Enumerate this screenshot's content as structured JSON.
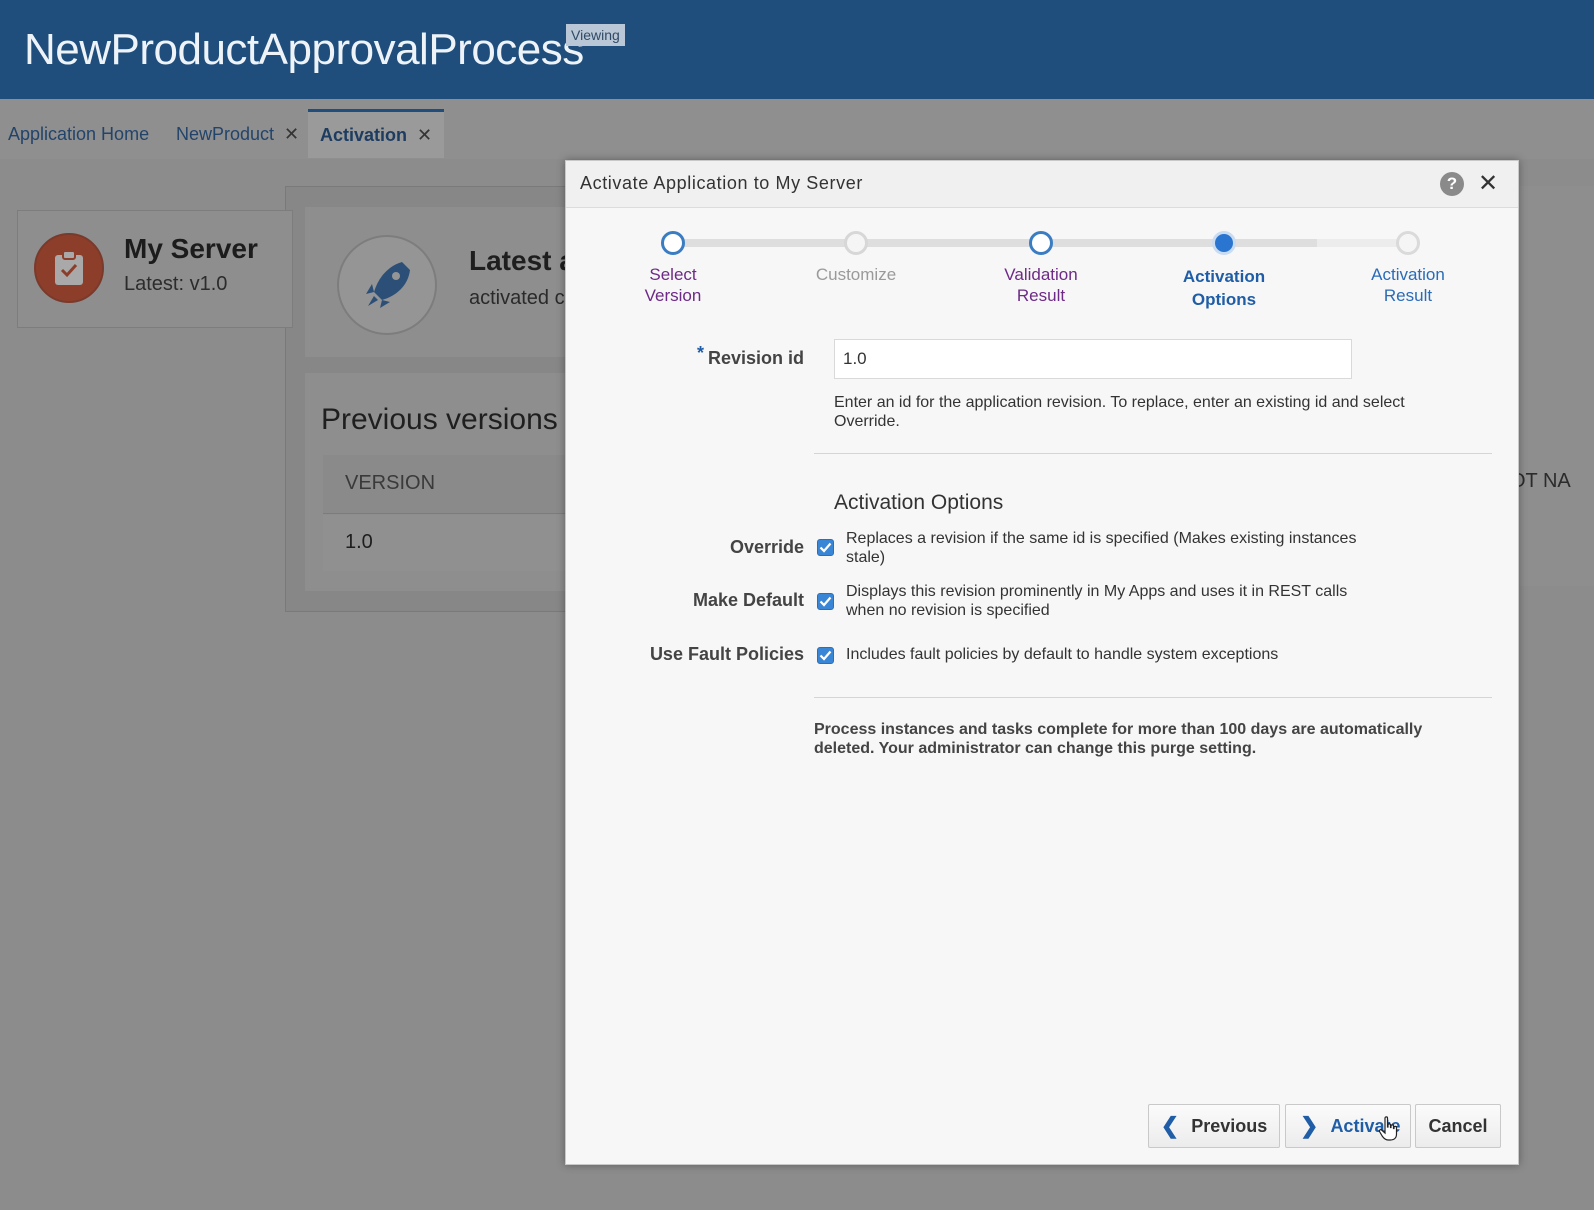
{
  "header": {
    "title": "NewProductApprovalProcess",
    "badge": "Viewing"
  },
  "tabs": [
    {
      "label": "Application Home",
      "closable": false
    },
    {
      "label": "NewProduct",
      "closable": true
    },
    {
      "label": "Activation",
      "closable": true,
      "active": true
    }
  ],
  "server_card": {
    "name": "My Server",
    "latest": "Latest: v1.0"
  },
  "latest_panel": {
    "title": "Latest a",
    "subtitle": "activated c"
  },
  "previous_versions": {
    "title": "Previous versions",
    "column": "VERSION",
    "rows": [
      "1.0"
    ],
    "peek_column": "OT NA"
  },
  "dialog": {
    "title": "Activate Application to My Server",
    "help_icon": "?",
    "close_icon": "✕",
    "steps": [
      {
        "label_line1": "Select",
        "label_line2": "Version",
        "state": "visited"
      },
      {
        "label_line1": "Customize",
        "label_line2": "",
        "state": "disabled"
      },
      {
        "label_line1": "Validation",
        "label_line2": "Result",
        "state": "visited"
      },
      {
        "label_line1": "Activation",
        "label_line2": "Options",
        "state": "current"
      },
      {
        "label_line1": "Activation",
        "label_line2": "Result",
        "state": "unvisited"
      }
    ],
    "revision": {
      "label": "Revision id",
      "required_marker": "*",
      "value": "1.0",
      "help": "Enter an id for the application revision. To replace, enter an existing id and select Override."
    },
    "options_heading": "Activation Options",
    "options": [
      {
        "label": "Override",
        "checked": true,
        "description": "Replaces a revision if the same id is specified (Makes existing instances stale)"
      },
      {
        "label": "Make Default",
        "checked": true,
        "description": "Displays this revision prominently in My Apps and uses it in REST calls when no revision is specified"
      },
      {
        "label": "Use Fault Policies",
        "checked": true,
        "description": "Includes fault policies by default to handle system exceptions"
      }
    ],
    "purge_note": "Process instances and tasks complete for more than 100 days are automatically deleted. Your administrator can change this purge setting.",
    "buttons": {
      "previous": "Previous",
      "activate": "Activate",
      "cancel": "Cancel"
    }
  },
  "colors": {
    "header_bg": "#1f4e7d",
    "accent": "#1f5da6",
    "visited_step": "#6d2a86",
    "checkbox": "#3a86d6"
  }
}
